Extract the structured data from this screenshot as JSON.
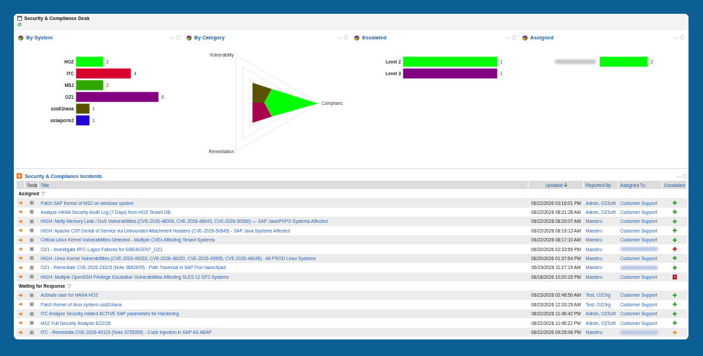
{
  "window": {
    "title": "Security & Compliance Desk"
  },
  "panels": [
    {
      "title": "By System",
      "kind": "bar",
      "chart_data": {
        "type": "bar",
        "orientation": "horizontal",
        "categories": [
          "HOZ",
          "ITC",
          "MS2",
          "OZ1",
          "ozs81hana",
          "ozsapcrm2"
        ],
        "values": [
          2,
          4,
          2,
          6,
          1,
          1
        ],
        "colors": [
          "#00ff00",
          "#d7002d",
          "#2ea800",
          "#800080",
          "#5a5200",
          "#2200d4"
        ],
        "data_labels": true
      }
    },
    {
      "title": "By Category",
      "kind": "radar",
      "axes": [
        "Vulnerability",
        "Complianc",
        "Remediation"
      ]
    },
    {
      "title": "Escalated",
      "kind": "bar",
      "chart_data": {
        "type": "bar",
        "orientation": "horizontal",
        "categories": [
          "Level 2",
          "Level 3"
        ],
        "values": [
          1,
          1
        ],
        "colors": [
          "#00ff00",
          "#800080"
        ],
        "data_labels": true
      }
    },
    {
      "title": "Assigned",
      "kind": "single-bar",
      "labels_hidden": true,
      "value": "2",
      "color": "#00ff00"
    }
  ],
  "incidents": {
    "title": "Security & Compliance Incidents",
    "columns": [
      {
        "label": "Tools",
        "sorted": false
      },
      {
        "label": "Title",
        "sorted": false
      },
      {
        "label": "Updated",
        "sorted": true
      },
      {
        "label": "Reported By",
        "sorted": false
      },
      {
        "label": "Assigned To",
        "sorted": false
      },
      {
        "label": "Escalation",
        "sorted": false
      }
    ],
    "groups": [
      {
        "label": "Assigned",
        "toggle": "▽",
        "rows": [
          {
            "title": "Patch SAP Kernel of MS2 on windows system",
            "updated": "06/22/2026 03:16:01 PM",
            "reported_by": "Admin, OZSoft",
            "assigned_to": "Customer Support",
            "escalation": {
              "kind": "dot",
              "color": "#3aa83a"
            }
          },
          {
            "title": "Analyze HANA Security Audit Log (7 Days) from HOZ Tenant DB",
            "updated": "06/22/2026 08:21:28 AM",
            "reported_by": "Admin, OZSoft",
            "assigned_to": "Customer Support",
            "escalation": {
              "kind": "dot",
              "color": "#3aa83a"
            }
          },
          {
            "title": "HIGH: Netty Memory Leak / DoS Vulnerabilities (CVE-2026-48006, CVE-2026-48043, CVE-2026-50560) — SAP Java/PI/PO Systems Affected",
            "updated": "06/22/2026 08:20:07 AM",
            "reported_by": "Maestro",
            "assigned_to": "Customer Support",
            "escalation": {
              "kind": "dot",
              "color": "#3aa83a"
            }
          },
          {
            "title": "HIGH: Apache CXF Denial of Service via Unbounded Attachment Headers (CVE-2026-50645) - SAP Java Systems Affected",
            "updated": "06/22/2026 08:19:13 AM",
            "reported_by": "Maestro",
            "assigned_to": "Customer Support",
            "escalation": {
              "kind": "dot",
              "color": "#3aa83a"
            }
          },
          {
            "title": "Critical Linux Kernel Vulnerabilities Detected - Multiple CVEs Affecting Tenant Systems",
            "updated": "06/22/2026 08:17:10 AM",
            "reported_by": "Maestro",
            "assigned_to": "Customer Support",
            "escalation": {
              "kind": "dot",
              "color": "#3aa83a"
            }
          },
          {
            "title": "OZ1 - Investigate RFC Logon Failures for SMDAGENT_OZ1",
            "updated": "06/20/2026 02:33:59 PM",
            "reported_by": "Maestro",
            "assigned_hidden": true,
            "escalation": {
              "kind": "dot",
              "color": "#e02020"
            }
          },
          {
            "title": "HIGH: Linux Kernel Vulnerabilities (CVE-2026-46033, CVE-2026-46020, CVE-2026-45995, CVE-2026-46045) - All PROD Linux Systems",
            "updated": "06/20/2026 01:37:54 PM",
            "reported_by": "Maestro",
            "assigned_hidden": false,
            "assigned_to": "Customer Support",
            "escalation": {
              "kind": "dot",
              "color": "#3aa83a"
            }
          },
          {
            "title": "OZ1 - Remediate CVE-2026-24315 (Note 3682699) - Path Traversal in SAP Fiori launchpad",
            "updated": "06/19/2026 11:27:19 AM",
            "reported_by": "Maestro",
            "assigned_hidden": true,
            "escalation": {
              "kind": "dot",
              "color": "#3aa83a"
            }
          },
          {
            "title": "HIGH: Multiple OpenSSH Privilege Escalation Vulnerabilities Affecting SLES 12 SP2 Systems",
            "updated": "06/18/2026 10:20:15 PM",
            "reported_by": "Maestro",
            "assigned_to": "Customer Support",
            "escalation": {
              "kind": "badge",
              "color": "#c0101a"
            }
          }
        ]
      },
      {
        "label": "Waiting for Response",
        "toggle": "▽",
        "rows": [
          {
            "title": "Activate user for HANA HOZ",
            "updated": "06/23/2026 02:48:50 AM",
            "reported_by": "Test, OZOrg",
            "assigned_to": "Customer Support",
            "escalation": {
              "kind": "dot",
              "color": "#3aa83a"
            }
          },
          {
            "title": "Patch Kernel of linux system ozs81hana",
            "updated": "06/23/2026 12:33:29 AM",
            "reported_by": "Test, OZOrg",
            "assigned_to": "Customer Support",
            "escalation": {
              "kind": "dot",
              "color": "#3aa83a"
            }
          },
          {
            "title": "ITC Analyze Security related ACTIVE SAP parameters for Hardening",
            "updated": "06/22/2026 11:46:42 PM",
            "reported_by": "Admin, OZSoft",
            "assigned_to": "Customer Support",
            "escalation": {
              "kind": "dot",
              "color": "#3aa83a"
            }
          },
          {
            "title": "MS2 Full Security Analysis 6/22/26",
            "updated": "06/22/2026 11:45:22 PM",
            "reported_by": "Admin, OZSoft",
            "assigned_to": "Customer Support",
            "escalation": {
              "kind": "dot",
              "color": "#3aa83a"
            }
          },
          {
            "title": "ITC - Remediate CVE-2026-40129 (Note 3735359) - Code Injection in SAP AS ABAP",
            "updated": "06/22/2026 09:25:06 PM",
            "reported_by": "Maestro",
            "assigned_hidden": true,
            "escalation": {
              "kind": "dot",
              "color": "#f0a030"
            }
          }
        ]
      }
    ]
  }
}
